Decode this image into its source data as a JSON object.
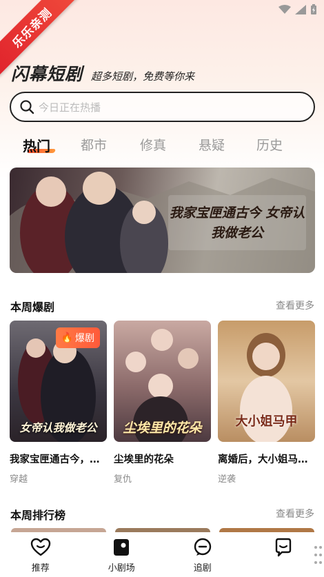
{
  "ribbon": {
    "label": "乐乐亲测"
  },
  "header": {
    "title": "闪幕短剧",
    "slogan": "超多短剧，免费等你来"
  },
  "search": {
    "placeholder": "今日正在热播"
  },
  "tabs": [
    {
      "label": "热门",
      "active": true
    },
    {
      "label": "都市",
      "active": false
    },
    {
      "label": "修真",
      "active": false
    },
    {
      "label": "悬疑",
      "active": false
    },
    {
      "label": "历史",
      "active": false
    }
  ],
  "banner": {
    "poster_text": "我家宝匣通古今 女帝认我做老公"
  },
  "weekly_hot": {
    "title": "本周爆剧",
    "see_more": "查看更多",
    "cards": [
      {
        "title": "我家宝匣通古今，女帝认我做老公",
        "tag": "穿越",
        "badge": "爆剧",
        "poster_text": "女帝认我做老公"
      },
      {
        "title": "尘埃里的花朵",
        "tag": "复仇",
        "poster_text": "尘埃里的花朵"
      },
      {
        "title": "离婚后，大小姐马甲飒爆全球",
        "tag": "逆袭",
        "poster_text": "大小姐马甲"
      }
    ]
  },
  "weekly_rank": {
    "title": "本周排行榜",
    "see_more": "查看更多"
  },
  "bottom_nav": [
    {
      "label": "推荐"
    },
    {
      "label": "小剧场"
    },
    {
      "label": "追剧"
    },
    {
      "label": ""
    }
  ],
  "colors": {
    "accent": "#ff5a3a",
    "ribbon": "#e0232c",
    "text": "#111111",
    "muted": "#888888"
  }
}
